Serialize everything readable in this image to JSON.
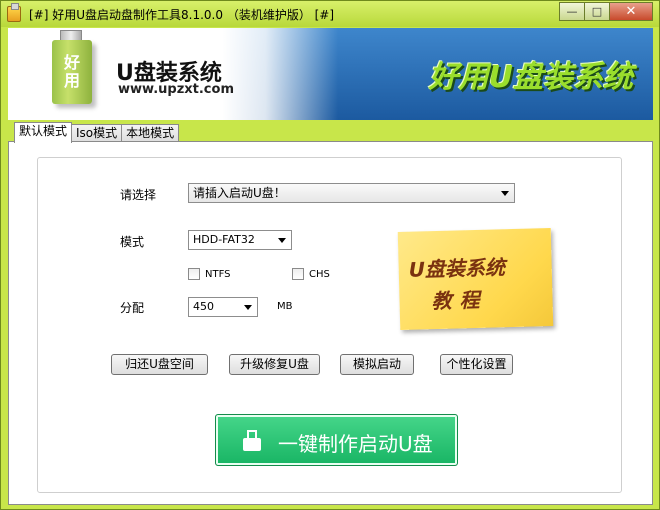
{
  "window": {
    "title": "[#] 好用U盘启动盘制作工具8.1.0.0 （装机维护版） [#]",
    "minimize": "—",
    "maximize": "□",
    "close": "✕"
  },
  "banner": {
    "usb_text_1": "好",
    "usb_text_2": "用",
    "brand_title": "U盘装系统",
    "brand_url": "www.upzxt.com",
    "slogan": "好用U盘装系统"
  },
  "tabs": [
    {
      "label": "默认模式",
      "active": true
    },
    {
      "label": "Iso模式",
      "active": false
    },
    {
      "label": "本地模式",
      "active": false
    }
  ],
  "form": {
    "select_label": "请选择",
    "select_value": "请插入启动U盘！",
    "mode_label": "模式",
    "mode_value": "HDD-FAT32",
    "ntfs_label": "NTFS",
    "chs_label": "CHS",
    "alloc_label": "分配",
    "alloc_value": "450",
    "alloc_unit": "MB"
  },
  "note": {
    "line1": "U盘装系统",
    "line2": "教程"
  },
  "buttons": {
    "restore": "归还U盘空间",
    "upgrade": "升级修复U盘",
    "simulate": "模拟启动",
    "personalize": "个性化设置",
    "one_key": "一键制作启动U盘"
  },
  "colors": {
    "window_frame": "#c8e64a",
    "banner_blue": "#1c5aa0",
    "primary_button": "#18b564",
    "note_yellow": "#ffd84c"
  }
}
